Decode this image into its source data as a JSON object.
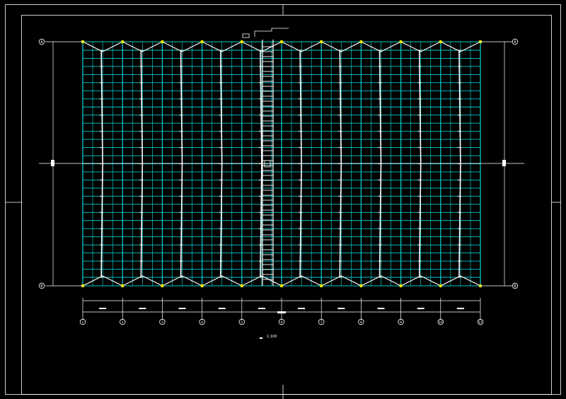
{
  "drawing": {
    "background": "#000000",
    "colors": {
      "frame": "#ffffff",
      "grid": "#00c8c8",
      "member": "#ffffff",
      "node": "#e8e800"
    },
    "plan_title": "",
    "plan_scale": "1:100",
    "column_axes": [
      "1",
      "2",
      "3",
      "4",
      "5",
      "6",
      "7",
      "8",
      "9",
      "10",
      "11"
    ],
    "row_axes": [
      "A",
      "B"
    ],
    "purlin_rows": 29
  }
}
